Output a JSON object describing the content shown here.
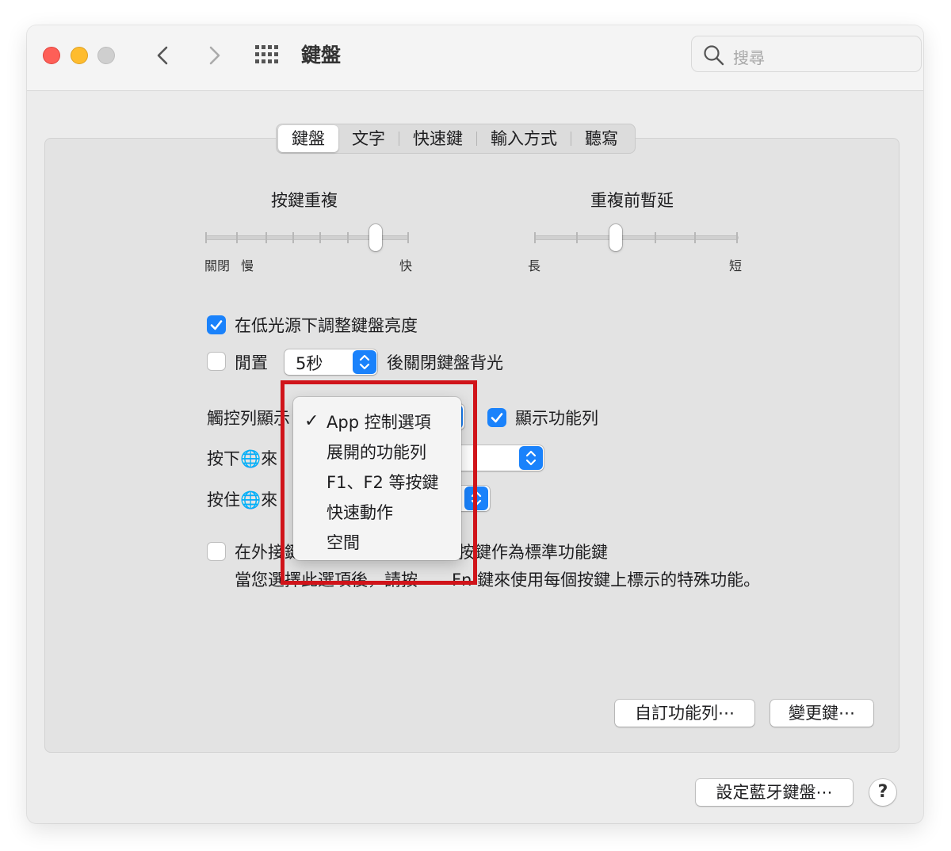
{
  "window": {
    "title": "鍵盤"
  },
  "search": {
    "placeholder": "搜尋"
  },
  "tabs": [
    {
      "label": "鍵盤"
    },
    {
      "label": "文字"
    },
    {
      "label": "快速鍵"
    },
    {
      "label": "輸入方式"
    },
    {
      "label": "聽寫"
    }
  ],
  "key_repeat": {
    "title": "按鍵重複",
    "left1": "關閉",
    "left2": "慢",
    "right": "快",
    "value_step": 6,
    "steps": 8
  },
  "delay_until_repeat": {
    "title": "重複前暫延",
    "left": "長",
    "right": "短",
    "value_step": 2,
    "steps": 6
  },
  "adjust_brightness": {
    "label": "在低光源下調整鍵盤亮度",
    "checked": true
  },
  "backlight_off": {
    "label_before": "閒置",
    "selected": "5秒",
    "label_after": "後關閉鍵盤背光",
    "checked": false
  },
  "touchbar_row": {
    "label": "觸控列顯示",
    "show_control_strip": "顯示功能列",
    "checked": true
  },
  "press_globe_row": {
    "label": "按下🌐來"
  },
  "hold_globe_row": {
    "label": "按住🌐來"
  },
  "fn_keys": {
    "label_a": "在外接鍵",
    "label_b": "按鍵作為標準功能鍵",
    "description_a": "當您選擇此選項後，請按",
    "description_b": "Fn 鍵來使用每個按鍵上標示的特殊功能。",
    "checked": false
  },
  "dropdown_menu": {
    "items": [
      "App 控制選項",
      "展開的功能列",
      "F1、F2 等按鍵",
      "快速動作",
      "空間"
    ],
    "checkmark": "✓"
  },
  "buttons": {
    "customize_control_strip": "自訂功能列⋯",
    "modifier_keys": "變更鍵⋯",
    "setup_bluetooth_keyboard": "設定藍牙鍵盤⋯",
    "help": "?"
  },
  "colors": {
    "accent": "#1a82fb",
    "highlight_box": "#d0141a"
  }
}
